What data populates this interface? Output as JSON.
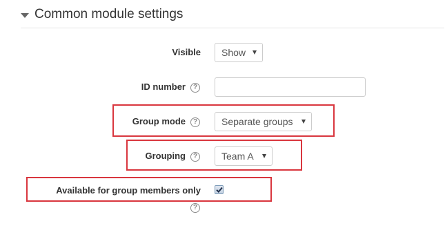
{
  "section": {
    "title": "Common module settings"
  },
  "fields": {
    "visible": {
      "label": "Visible",
      "value": "Show"
    },
    "id_number": {
      "label": "ID number",
      "value": ""
    },
    "group_mode": {
      "label": "Group mode",
      "value": "Separate groups"
    },
    "grouping": {
      "label": "Grouping",
      "value": "Team A"
    },
    "available_for_group_members_only": {
      "label": "Available for group members only",
      "checked": true
    }
  },
  "icons": {
    "help": "?"
  },
  "colors": {
    "highlight": "#d9363e",
    "text": "#333333",
    "border": "#cccccc"
  }
}
